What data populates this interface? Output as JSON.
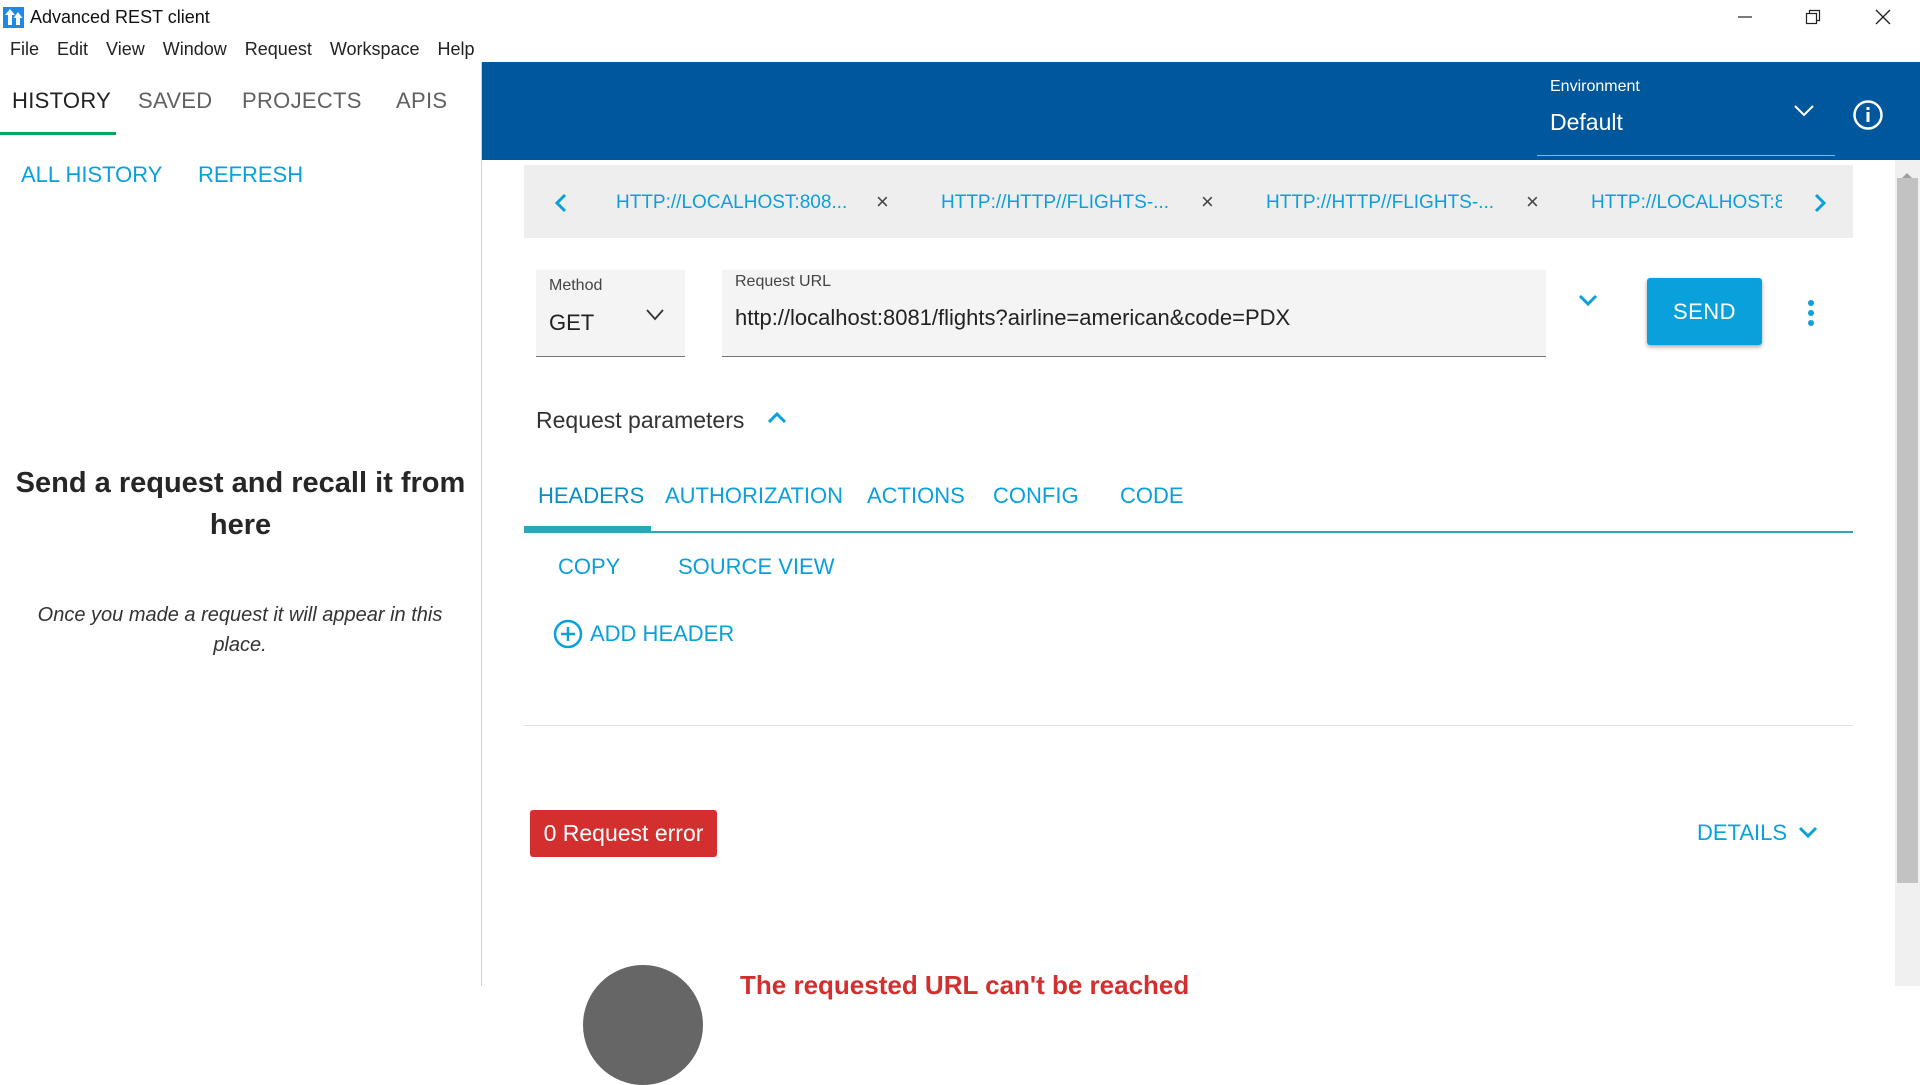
{
  "window": {
    "title": "Advanced REST client"
  },
  "menu": [
    "File",
    "Edit",
    "View",
    "Window",
    "Request",
    "Workspace",
    "Help"
  ],
  "left_panel": {
    "tabs": [
      "HISTORY",
      "SAVED",
      "PROJECTS",
      "APIS"
    ],
    "active_tab": "HISTORY",
    "actions": [
      "ALL HISTORY",
      "REFRESH"
    ],
    "empty_title": "Send a request and recall it from here",
    "empty_text": "Once you made a request it will appear in this place."
  },
  "environment": {
    "label": "Environment",
    "value": "Default"
  },
  "request_tabs": [
    {
      "label": "HTTP://LOCALHOST:808..."
    },
    {
      "label": "HTTP://HTTP//FLIGHTS-..."
    },
    {
      "label": "HTTP://HTTP//FLIGHTS-..."
    },
    {
      "label": "HTTP://LOCALHOST:8"
    }
  ],
  "request": {
    "method_label": "Method",
    "method": "GET",
    "url_label": "Request URL",
    "url": "http://localhost:8081/flights?airline=american&code=PDX",
    "send_label": "SEND"
  },
  "params": {
    "title": "Request parameters",
    "tabs": [
      "HEADERS",
      "AUTHORIZATION",
      "ACTIONS",
      "CONFIG",
      "CODE"
    ],
    "active_tab": "HEADERS",
    "header_actions": [
      "COPY",
      "SOURCE VIEW"
    ],
    "add_header_label": "ADD HEADER"
  },
  "response": {
    "error_badge": "0 Request error",
    "details_label": "DETAILS",
    "error_message": "The requested URL can't be reached"
  },
  "colors": {
    "accent": "#0aa0dc",
    "header_bg": "#01579b",
    "error": "#d32f2f",
    "history_indicator": "#00a65a"
  }
}
